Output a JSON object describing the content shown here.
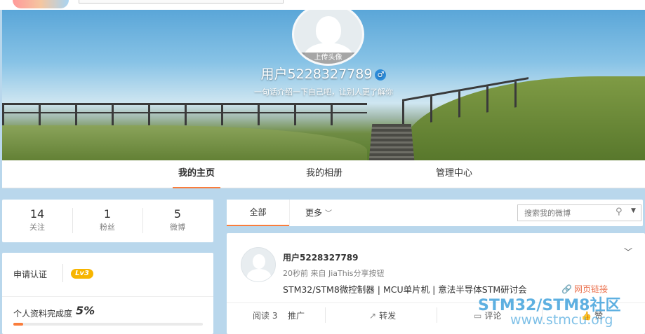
{
  "profile": {
    "upload_avatar": "上传头像",
    "username": "用户5228327789",
    "gender_icon": "♂",
    "intro": "一句话介绍一下自己吧，让别人更了解你"
  },
  "nav": {
    "home": "我的主页",
    "album": "我的相册",
    "manage": "管理中心"
  },
  "stats": [
    {
      "num": "14",
      "label": "关注"
    },
    {
      "num": "1",
      "label": "粉丝"
    },
    {
      "num": "5",
      "label": "微博"
    }
  ],
  "verify": {
    "apply": "申请认证",
    "level": "Lv3",
    "completion_label": "个人资料完成度",
    "completion_value": "5%",
    "completion_fraction": 0.05
  },
  "filter": {
    "all": "全部",
    "more": "更多",
    "search_placeholder": "搜索我的微博"
  },
  "feed": {
    "name": "用户5228327789",
    "meta": "20秒前 来自 JiaThis分享按钮",
    "text": "STM32/STM8微控制器 | MCU单片机 | 意法半导体STM研讨会",
    "link": "网页链接",
    "read": "阅读 3",
    "promote": "推广",
    "forward": "转发",
    "comment": "评论",
    "like": "赞"
  },
  "watermark": {
    "line1": "STM32/STM8社区",
    "line2": "www.stmcu.org"
  },
  "colors": {
    "accent": "#fa7d3c",
    "link": "#eb7350",
    "level_badge": "#f7b500",
    "page_bg": "#b9d7ec"
  }
}
